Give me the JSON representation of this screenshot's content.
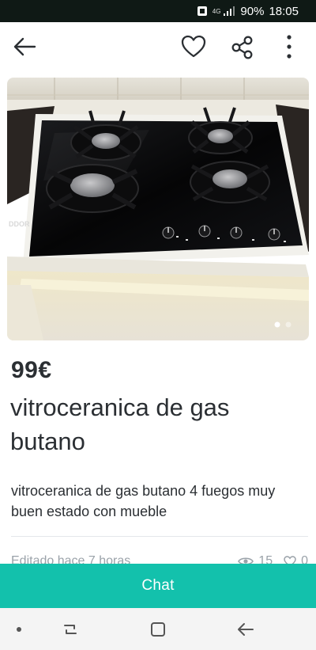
{
  "status_bar": {
    "network": "4G",
    "battery": "90%",
    "time": "18:05",
    "icons": [
      "notification-icon",
      "signal-icon",
      "battery-icon"
    ]
  },
  "toolbar": {
    "icons": [
      "back-arrow-icon",
      "heart-icon",
      "share-icon",
      "more-vertical-icon"
    ]
  },
  "listing": {
    "photo_brand_text": "DDOR",
    "price": "99€",
    "title": "vitroceranica de gas butano",
    "description": "vitroceranica de gas butano 4 fuegos muy buen estado con mueble",
    "edited": "Editado hace 7 horas",
    "views": "15",
    "favorites": "0"
  },
  "chat": {
    "label": "Chat"
  },
  "colors": {
    "accent": "#13c1ac",
    "text": "#2b2f33",
    "muted": "#9aa2a9",
    "status_bar": "#0f1915"
  },
  "nav": {
    "icons": [
      "nav-dot",
      "recent-apps-icon",
      "home-icon",
      "back-icon"
    ]
  }
}
